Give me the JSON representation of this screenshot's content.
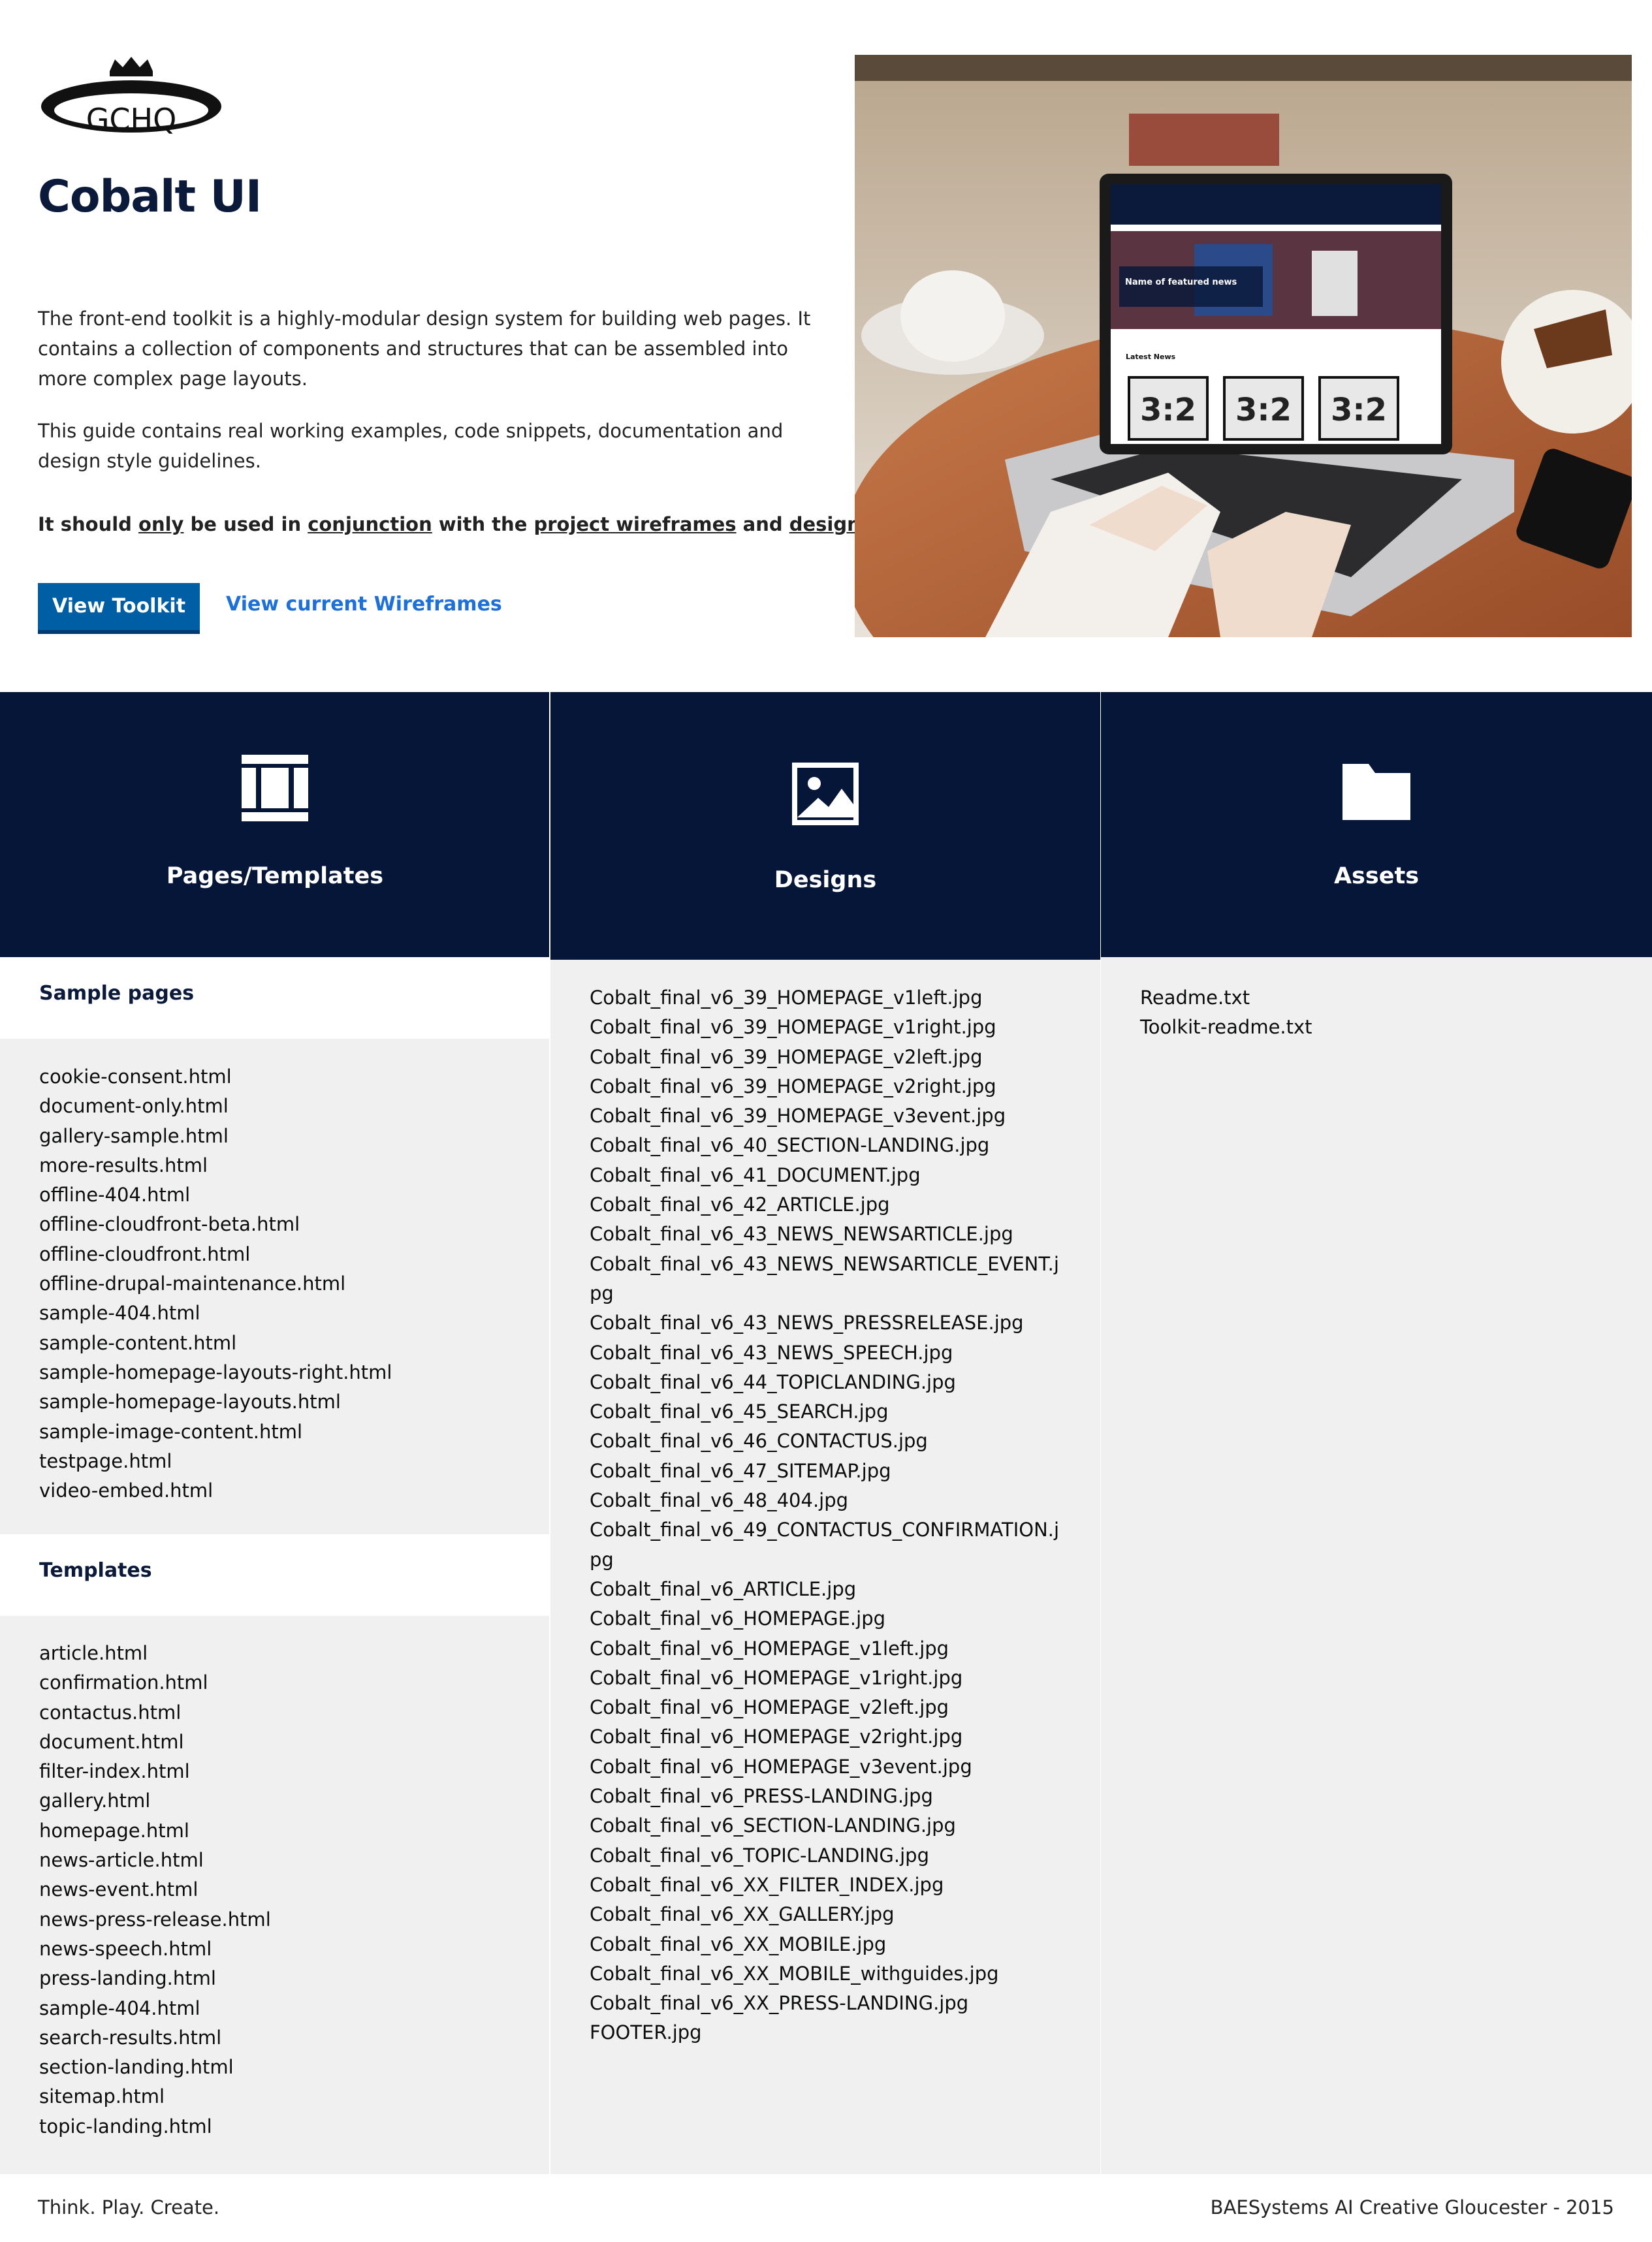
{
  "header": {
    "logo_text": "GCHQ",
    "title": "Cobalt UI",
    "intro_1": "The front-end toolkit is a highly-modular design system for building web pages. It contains a collection of components and structures that can be assembled into more complex page layouts.",
    "intro_2": "This guide contains real working examples, code snippets, documentation and design style guidelines.",
    "notice": {
      "part_1": "It should ",
      "only": "only",
      "part_2": " be used in ",
      "conjunction": "conjunction",
      "part_3": " with the ",
      "wireframes": "project wireframes",
      "part_4": " and ",
      "designs": "designs"
    },
    "button_toolkit": "View Toolkit",
    "link_wireframes": "View current Wireframes"
  },
  "hero_image": {
    "laptop_screen": {
      "featured_title": "Name of featured news",
      "latest_news": "Latest News",
      "tiles": [
        "3:2",
        "3:2",
        "3:2"
      ]
    }
  },
  "columns": {
    "pages": {
      "title": "Pages/Templates",
      "icon": "layout-columns-icon",
      "sample_heading": "Sample pages",
      "sample_pages": [
        "cookie-consent.html",
        "document-only.html",
        "gallery-sample.html",
        "more-results.html",
        "offline-404.html",
        "offline-cloudfront-beta.html",
        "offline-cloudfront.html",
        "offline-drupal-maintenance.html",
        "sample-404.html",
        "sample-content.html",
        "sample-homepage-layouts-right.html",
        "sample-homepage-layouts.html",
        "sample-image-content.html",
        "testpage.html",
        "video-embed.html"
      ],
      "templates_heading": "Templates",
      "templates": [
        "article.html",
        "confirmation.html",
        "contactus.html",
        "document.html",
        "filter-index.html",
        "gallery.html",
        "homepage.html",
        "news-article.html",
        "news-event.html",
        "news-press-release.html",
        "news-speech.html",
        "press-landing.html",
        "sample-404.html",
        "search-results.html",
        "section-landing.html",
        "sitemap.html",
        "topic-landing.html"
      ]
    },
    "designs": {
      "title": "Designs",
      "icon": "image-icon",
      "files": [
        "Cobalt_final_v6_39_HOMEPAGE_v1left.jpg",
        "Cobalt_final_v6_39_HOMEPAGE_v1right.jpg",
        "Cobalt_final_v6_39_HOMEPAGE_v2left.jpg",
        "Cobalt_final_v6_39_HOMEPAGE_v2right.jpg",
        "Cobalt_final_v6_39_HOMEPAGE_v3event.jpg",
        "Cobalt_final_v6_40_SECTION-LANDING.jpg",
        "Cobalt_final_v6_41_DOCUMENT.jpg",
        "Cobalt_final_v6_42_ARTICLE.jpg",
        "Cobalt_final_v6_43_NEWS_NEWSARTICLE.jpg",
        "Cobalt_final_v6_43_NEWS_NEWSARTICLE_EVENT.jpg",
        "Cobalt_final_v6_43_NEWS_PRESSRELEASE.jpg",
        "Cobalt_final_v6_43_NEWS_SPEECH.jpg",
        "Cobalt_final_v6_44_TOPICLANDING.jpg",
        "Cobalt_final_v6_45_SEARCH.jpg",
        "Cobalt_final_v6_46_CONTACTUS.jpg",
        "Cobalt_final_v6_47_SITEMAP.jpg",
        "Cobalt_final_v6_48_404.jpg",
        "Cobalt_final_v6_49_CONTACTUS_CONFIRMATION.jpg",
        "Cobalt_final_v6_ARTICLE.jpg",
        "Cobalt_final_v6_HOMEPAGE.jpg",
        "Cobalt_final_v6_HOMEPAGE_v1left.jpg",
        "Cobalt_final_v6_HOMEPAGE_v1right.jpg",
        "Cobalt_final_v6_HOMEPAGE_v2left.jpg",
        "Cobalt_final_v6_HOMEPAGE_v2right.jpg",
        "Cobalt_final_v6_HOMEPAGE_v3event.jpg",
        "Cobalt_final_v6_PRESS-LANDING.jpg",
        "Cobalt_final_v6_SECTION-LANDING.jpg",
        "Cobalt_final_v6_TOPIC-LANDING.jpg",
        "Cobalt_final_v6_XX_FILTER_INDEX.jpg",
        "Cobalt_final_v6_XX_GALLERY.jpg",
        "Cobalt_final_v6_XX_MOBILE.jpg",
        "Cobalt_final_v6_XX_MOBILE_withguides.jpg",
        "Cobalt_final_v6_XX_PRESS-LANDING.jpg",
        "FOOTER.jpg"
      ]
    },
    "assets": {
      "title": "Assets",
      "icon": "folder-icon",
      "files": [
        "Readme.txt",
        "Toolkit-readme.txt"
      ]
    }
  },
  "footer": {
    "left": "Think. Play. Create.",
    "right": "BAESystems AI Creative Gloucester - 2015"
  },
  "colors": {
    "navy": "#061639",
    "button_blue": "#005ea5",
    "link_blue": "#1d70d8",
    "panel_grey": "#f0f0f0"
  }
}
